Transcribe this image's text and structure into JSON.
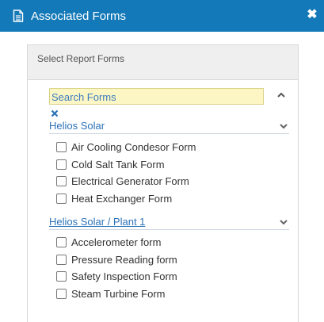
{
  "dialog": {
    "title": "Associated Forms",
    "title_icon": "document-icon",
    "close_icon": "close-icon"
  },
  "panel": {
    "header": "Select Report Forms",
    "search": {
      "placeholder": "Search Forms",
      "value": ""
    },
    "groups": [
      {
        "label": "Helios Solar",
        "forms": [
          {
            "label": "Air Cooling Condesor Form",
            "checked": false
          },
          {
            "label": "Cold Salt Tank Form",
            "checked": false
          },
          {
            "label": "Electrical Generator Form",
            "checked": false
          },
          {
            "label": "Heat Exchanger Form",
            "checked": false
          }
        ]
      },
      {
        "label": "Helios Solar / Plant 1",
        "forms": [
          {
            "label": "Accelerometer form",
            "checked": false
          },
          {
            "label": "Pressure Reading form",
            "checked": false
          },
          {
            "label": "Safety Inspection Form",
            "checked": false
          },
          {
            "label": "Steam Turbine Form",
            "checked": false
          }
        ]
      }
    ]
  },
  "colors": {
    "titlebar": "#1479b8",
    "link": "#2c73b8",
    "search_bg": "#fbf6c4"
  }
}
